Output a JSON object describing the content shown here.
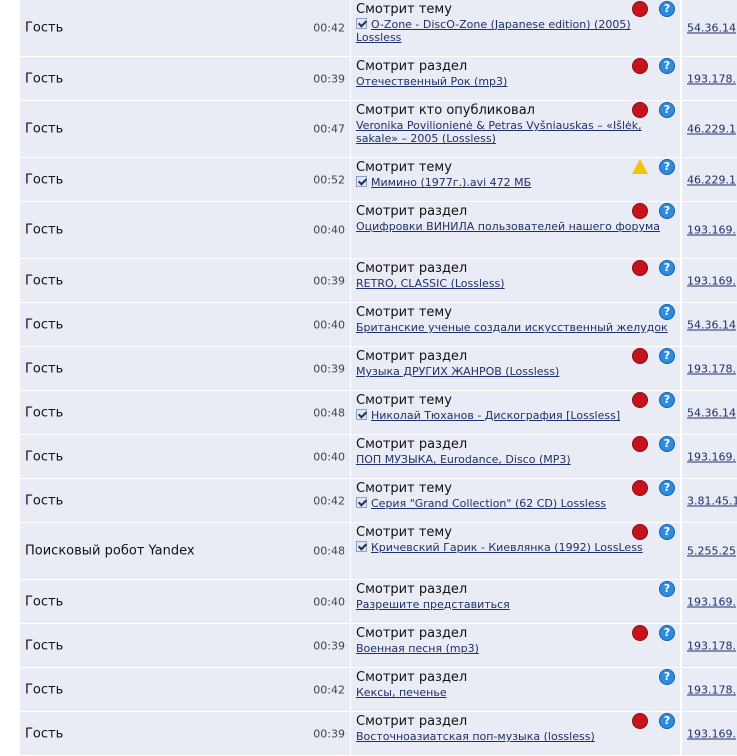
{
  "rows": [
    {
      "name": "Гость",
      "time": "00:42",
      "action": "Смотрит тему",
      "check": true,
      "link": "O-Zone - DiscO-Zone (Japanese edition) (2005) Lossless",
      "stop": true,
      "warn": false,
      "ip": "54.36.14",
      "tall": true
    },
    {
      "name": "Гость",
      "time": "00:39",
      "action": "Смотрит раздел",
      "check": false,
      "link": "Отечественный Рок (mp3)",
      "stop": true,
      "warn": false,
      "ip": "193.178.",
      "tall": false
    },
    {
      "name": "Гость",
      "time": "00:47",
      "action": "Смотрит кто опубликовал",
      "check": false,
      "link": "Veronika Povilionienė & Petras Vyšniauskas – «Išlėk, sakale» – 2005 (Lossless)",
      "stop": true,
      "warn": false,
      "ip": "46.229.1",
      "tall": true
    },
    {
      "name": "Гость",
      "time": "00:52",
      "action": "Смотрит тему",
      "check": true,
      "link": "Мимино (1977г.).avi 472 МБ",
      "stop": false,
      "warn": true,
      "ip": "46.229.1",
      "tall": false
    },
    {
      "name": "Гость",
      "time": "00:40",
      "action": "Смотрит раздел",
      "check": false,
      "link": "Оцифровки ВИНИЛА пользователей нашего форума",
      "stop": true,
      "warn": false,
      "ip": "193.169.",
      "tall": true
    },
    {
      "name": "Гость",
      "time": "00:39",
      "action": "Смотрит раздел",
      "check": false,
      "link": "RETRO, CLASSIC (Lossless)",
      "stop": true,
      "warn": false,
      "ip": "193.169.",
      "tall": false
    },
    {
      "name": "Гость",
      "time": "00:40",
      "action": "Смотрит тему",
      "check": false,
      "link": "Британские ученые создали искусственный желудок",
      "stop": false,
      "warn": false,
      "ip": "54.36.14",
      "tall": false
    },
    {
      "name": "Гость",
      "time": "00:39",
      "action": "Смотрит раздел",
      "check": false,
      "link": "Музыка ДРУГИХ ЖАНРОВ (Lossless)",
      "stop": true,
      "warn": false,
      "ip": "193.178.",
      "tall": false
    },
    {
      "name": "Гость",
      "time": "00:48",
      "action": "Смотрит тему",
      "check": true,
      "link": "Николай Тюханов - Дискография [Lossless]",
      "stop": true,
      "warn": false,
      "ip": "54.36.14",
      "tall": false
    },
    {
      "name": "Гость",
      "time": "00:40",
      "action": "Смотрит раздел",
      "check": false,
      "link": "ПОП МУЗЫКА, Eurodance, Disco (MP3)",
      "stop": true,
      "warn": false,
      "ip": "193.169.",
      "tall": false
    },
    {
      "name": "Гость",
      "time": "00:42",
      "action": "Смотрит тему",
      "check": true,
      "link": "Серия \"Grand Collection\" (62 CD) Lossless",
      "stop": true,
      "warn": false,
      "ip": "3.81.45.1",
      "tall": false
    },
    {
      "name": "Поисковый робот Yandex",
      "time": "00:48",
      "action": "Смотрит тему",
      "check": true,
      "link": "Кричевский Гарик - Киевлянка (1992) LossLess",
      "stop": true,
      "warn": false,
      "ip": "5.255.25",
      "tall": true
    },
    {
      "name": "Гость",
      "time": "00:40",
      "action": "Смотрит раздел",
      "check": false,
      "link": "Разрешите представиться",
      "stop": false,
      "warn": false,
      "ip": "193.169.",
      "tall": false
    },
    {
      "name": "Гость",
      "time": "00:39",
      "action": "Смотрит раздел",
      "check": false,
      "link": "Военная песня (mp3)",
      "stop": true,
      "warn": false,
      "ip": "193.178.",
      "tall": false
    },
    {
      "name": "Гость",
      "time": "00:42",
      "action": "Смотрит раздел",
      "check": false,
      "link": "Кексы, печенье",
      "stop": false,
      "warn": false,
      "ip": "193.178.",
      "tall": false
    },
    {
      "name": "Гость",
      "time": "00:39",
      "action": "Смотрит раздел",
      "check": false,
      "link": "Восточноазиатская поп-музыка (lossless)",
      "stop": true,
      "warn": false,
      "ip": "193.169.",
      "tall": false
    }
  ],
  "icons": {
    "stop": "stop-sign-icon",
    "help": "help-icon",
    "warning": "warning-icon",
    "check": "checkmark-icon"
  },
  "colors": {
    "row_bg": "#e9ecf5",
    "link": "#20306a",
    "stop": "#c7141c",
    "help": "#2c8de0",
    "warn": "#f5c400"
  }
}
